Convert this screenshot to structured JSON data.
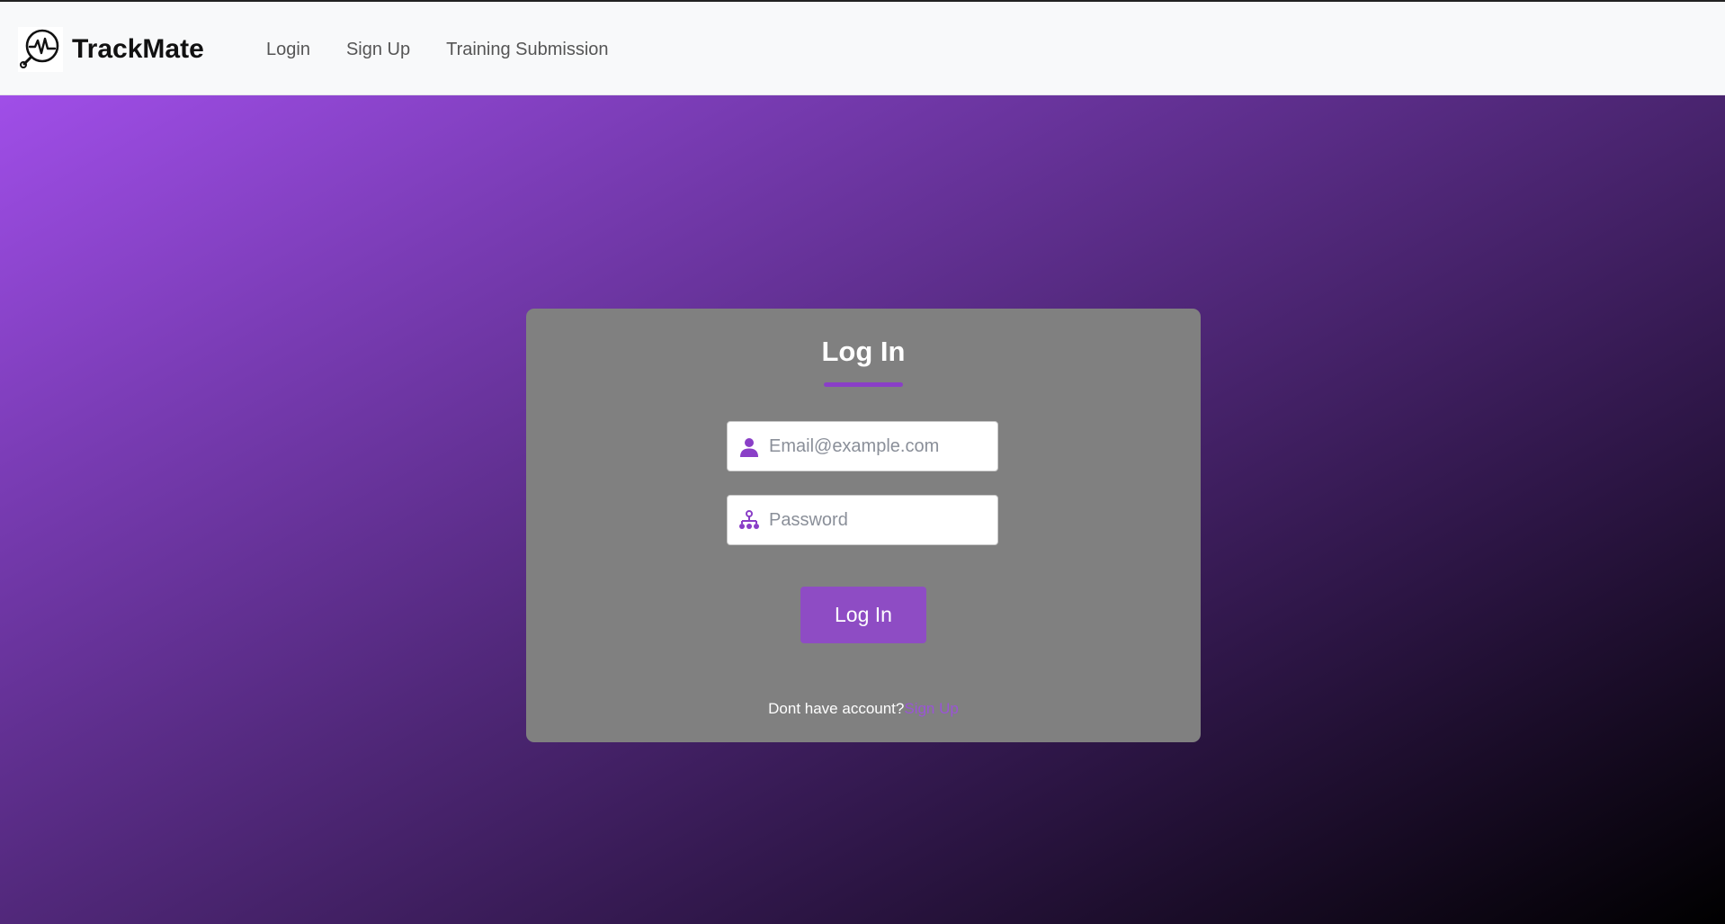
{
  "navbar": {
    "brand_name": "TrackMate",
    "links": [
      {
        "label": "Login"
      },
      {
        "label": "Sign Up"
      },
      {
        "label": "Training Submission"
      }
    ]
  },
  "login_card": {
    "title": "Log In",
    "email_placeholder": "Email@example.com",
    "password_placeholder": "Password",
    "submit_label": "Log In",
    "no_account_text": "Dont have account?",
    "signup_link_label": "Sign Up"
  },
  "icons": {
    "brand": "heartbeat-magnifier-icon",
    "email": "user-icon",
    "password": "network-icon"
  },
  "colors": {
    "accent": "#8e4cc4",
    "card_background": "#808080",
    "navbar_background": "#f8f9fa"
  }
}
